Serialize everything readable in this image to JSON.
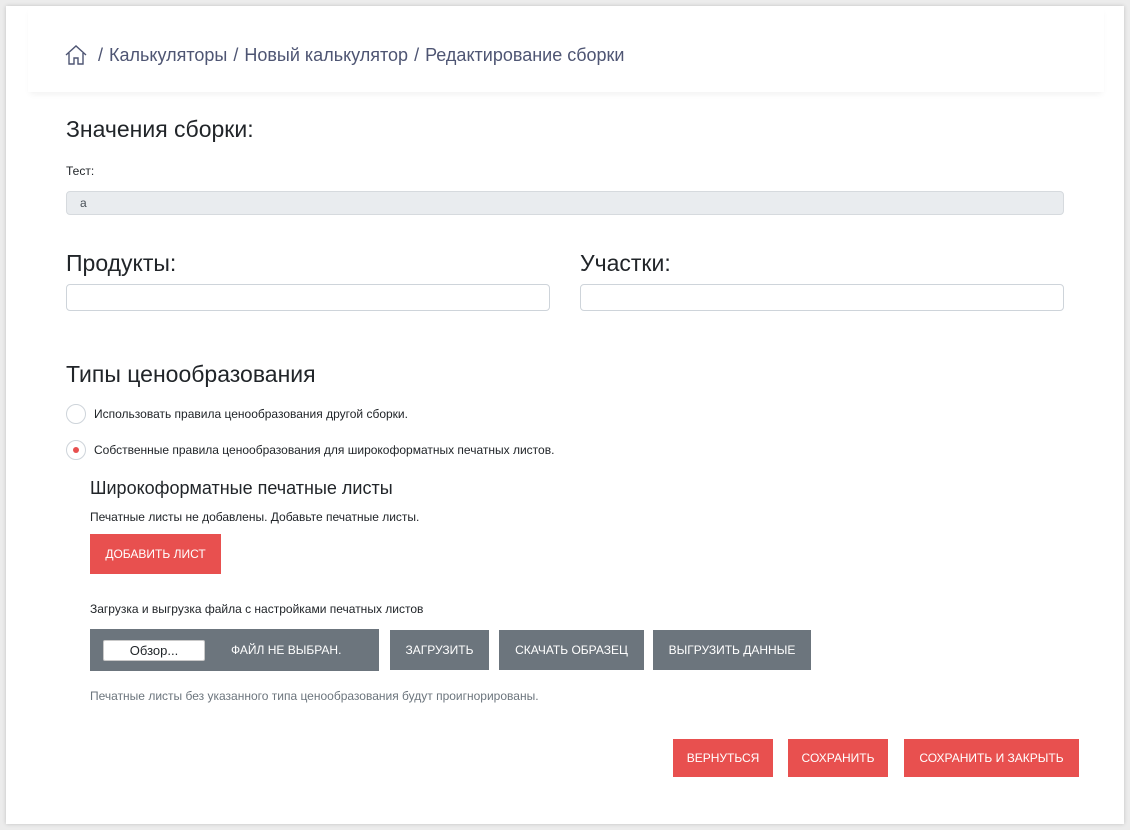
{
  "breadcrumb": {
    "home_icon": "home-icon",
    "separator": "/",
    "items": [
      "Калькуляторы",
      "Новый калькулятор",
      "Редактирование сборки"
    ]
  },
  "assembly": {
    "title": "Значения сборки:",
    "test_label": "Тест:",
    "test_value": "a"
  },
  "products": {
    "title": "Продукты:",
    "value": ""
  },
  "sections": {
    "title": "Участки:",
    "value": ""
  },
  "pricing": {
    "title": "Типы ценообразования",
    "options": [
      {
        "label": "Использовать правила ценообразования другой сборки.",
        "checked": false
      },
      {
        "label": "Собственные правила ценообразования для широкоформатных печатных листов.",
        "checked": true
      }
    ]
  },
  "sheets": {
    "title": "Широкоформатные печатные листы",
    "empty_message": "Печатные листы не добавлены. Добавьте печатные листы.",
    "add_button": "Добавить лист",
    "file_section_label": "Загрузка и выгрузка файла с настройками печатных листов",
    "browse_button": "Обзор...",
    "file_status": "Файл не выбран.",
    "upload_button": "Загрузить",
    "download_sample_button": "Скачать образец",
    "export_button": "Выгрузить данные",
    "note": "Печатные листы без указанного типа ценообразования будут проигнорированы."
  },
  "footer": {
    "back_button": "Вернуться",
    "save_button": "Сохранить",
    "save_close_button": "Сохранить и закрыть"
  },
  "colors": {
    "accent": "#e8504f",
    "secondary": "#6c757d",
    "breadcrumb": "#4e5573"
  }
}
